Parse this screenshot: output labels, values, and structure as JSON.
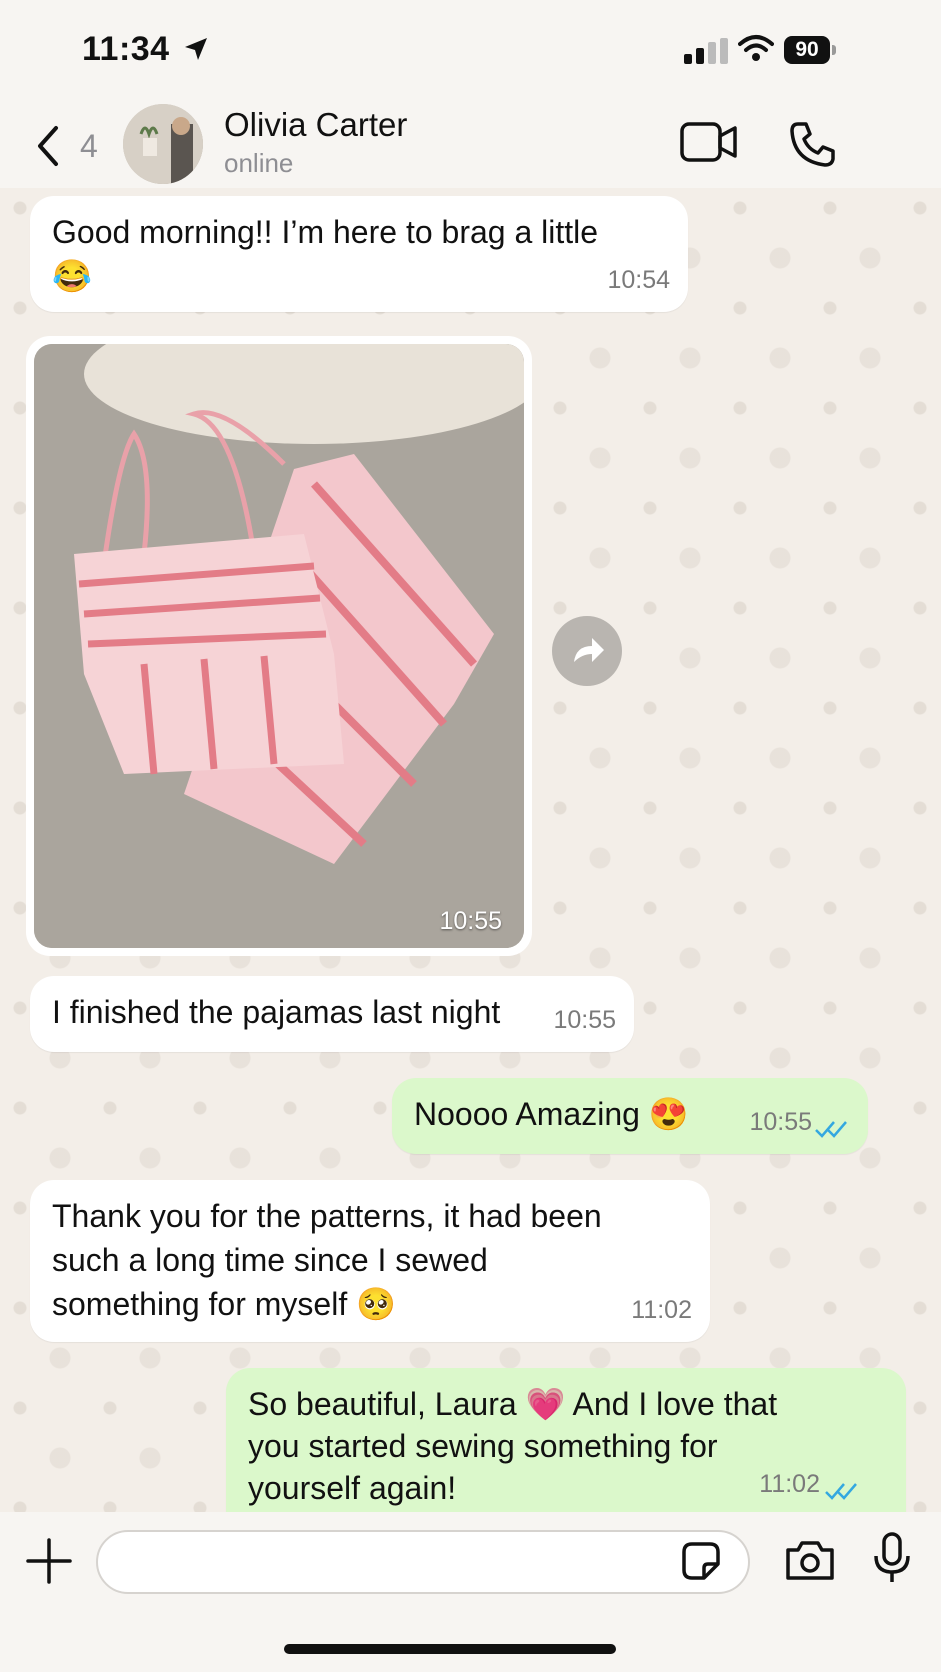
{
  "status_bar": {
    "time": "11:34",
    "battery": "90"
  },
  "header": {
    "back_count": "4",
    "contact_name": "Olivia Carter",
    "contact_status": "online"
  },
  "messages": [
    {
      "direction": "in",
      "lines": [
        "Good morning!! I’m here to brag a little",
        "😂"
      ],
      "time": "10:54"
    },
    {
      "direction": "in",
      "type": "photo",
      "time": "10:55"
    },
    {
      "direction": "in",
      "lines": [
        "I finished the pajamas last night"
      ],
      "time": "10:55"
    },
    {
      "direction": "out",
      "lines": [
        "Noooo Amazing 😍"
      ],
      "time": "10:55"
    },
    {
      "direction": "in",
      "lines": [
        "Thank you for the patterns, it had been",
        "such a long time since I sewed",
        "something for myself 🥺"
      ],
      "time": "11:02"
    },
    {
      "direction": "out",
      "lines": [
        "So beautiful, Laura 💗 And I love that",
        "you started sewing something for",
        "yourself again!"
      ],
      "time": "11:02"
    }
  ],
  "colors": {
    "incoming_bubble": "#ffffff",
    "outgoing_bubble": "#dbf8cb",
    "read_ticks": "#34a8e0",
    "chat_bg": "#f3eee8"
  },
  "icons": [
    "location-arrow-icon",
    "signal-icon",
    "wifi-icon",
    "battery-icon",
    "back-chevron-icon",
    "video-call-icon",
    "phone-icon",
    "forward-icon",
    "plus-icon",
    "sticker-icon",
    "camera-icon",
    "mic-icon"
  ]
}
